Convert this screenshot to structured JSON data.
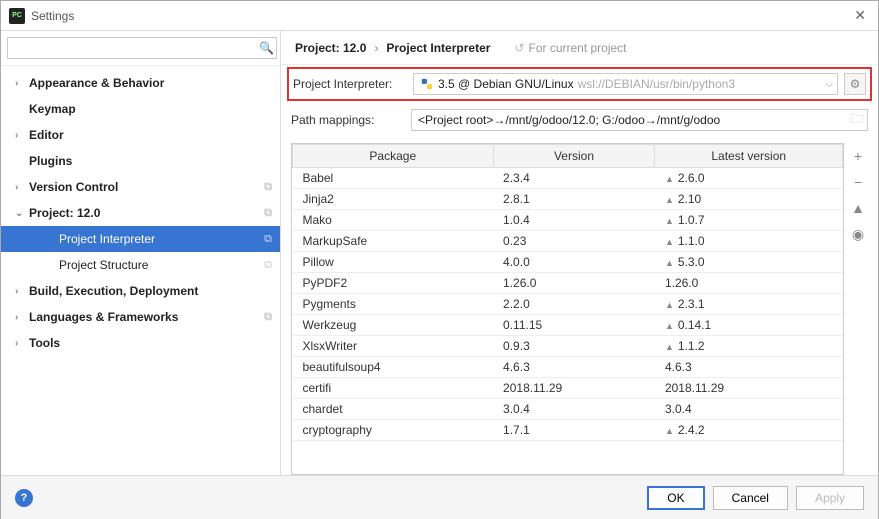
{
  "window": {
    "title": "Settings",
    "close": "✕"
  },
  "search": {
    "placeholder": ""
  },
  "sidebar": {
    "items": [
      {
        "label": "Appearance & Behavior",
        "bold": true,
        "arrow": "right"
      },
      {
        "label": "Keymap",
        "bold": true,
        "arrow": "none"
      },
      {
        "label": "Editor",
        "bold": true,
        "arrow": "right"
      },
      {
        "label": "Plugins",
        "bold": true,
        "arrow": "none"
      },
      {
        "label": "Version Control",
        "bold": true,
        "arrow": "right",
        "copy": true
      },
      {
        "label": "Project: 12.0",
        "bold": true,
        "arrow": "down",
        "copy": true
      },
      {
        "label": "Project Interpreter",
        "child": true,
        "selected": true,
        "copy": true
      },
      {
        "label": "Project Structure",
        "child": true,
        "copy": true
      },
      {
        "label": "Build, Execution, Deployment",
        "bold": true,
        "arrow": "right"
      },
      {
        "label": "Languages & Frameworks",
        "bold": true,
        "arrow": "right",
        "copy": true
      },
      {
        "label": "Tools",
        "bold": true,
        "arrow": "right"
      }
    ]
  },
  "breadcrumb": {
    "part1": "Project: 12.0",
    "part2": "Project Interpreter",
    "hint": "For current project"
  },
  "interpreter": {
    "label": "Project Interpreter:",
    "value_main": "3.5 @ Debian GNU/Linux",
    "value_grey": "wsl://DEBIAN/usr/bin/python3"
  },
  "pathmap": {
    "label": "Path mappings:",
    "value": "<Project root>→/mnt/g/odoo/12.0; G:/odoo→/mnt/g/odoo"
  },
  "table": {
    "headers": [
      "Package",
      "Version",
      "Latest version"
    ],
    "rows": [
      {
        "pkg": "Babel",
        "ver": "2.3.4",
        "latest": "2.6.0",
        "up": true
      },
      {
        "pkg": "Jinja2",
        "ver": "2.8.1",
        "latest": "2.10",
        "up": true
      },
      {
        "pkg": "Mako",
        "ver": "1.0.4",
        "latest": "1.0.7",
        "up": true
      },
      {
        "pkg": "MarkupSafe",
        "ver": "0.23",
        "latest": "1.1.0",
        "up": true
      },
      {
        "pkg": "Pillow",
        "ver": "4.0.0",
        "latest": "5.3.0",
        "up": true
      },
      {
        "pkg": "PyPDF2",
        "ver": "1.26.0",
        "latest": "1.26.0",
        "up": false
      },
      {
        "pkg": "Pygments",
        "ver": "2.2.0",
        "latest": "2.3.1",
        "up": true
      },
      {
        "pkg": "Werkzeug",
        "ver": "0.11.15",
        "latest": "0.14.1",
        "up": true
      },
      {
        "pkg": "XlsxWriter",
        "ver": "0.9.3",
        "latest": "1.1.2",
        "up": true
      },
      {
        "pkg": "beautifulsoup4",
        "ver": "4.6.3",
        "latest": "4.6.3",
        "up": false
      },
      {
        "pkg": "certifi",
        "ver": "2018.11.29",
        "latest": "2018.11.29",
        "up": false
      },
      {
        "pkg": "chardet",
        "ver": "3.0.4",
        "latest": "3.0.4",
        "up": false
      },
      {
        "pkg": "cryptography",
        "ver": "1.7.1",
        "latest": "2.4.2",
        "up": true
      }
    ]
  },
  "footer": {
    "ok": "OK",
    "cancel": "Cancel",
    "apply": "Apply"
  }
}
